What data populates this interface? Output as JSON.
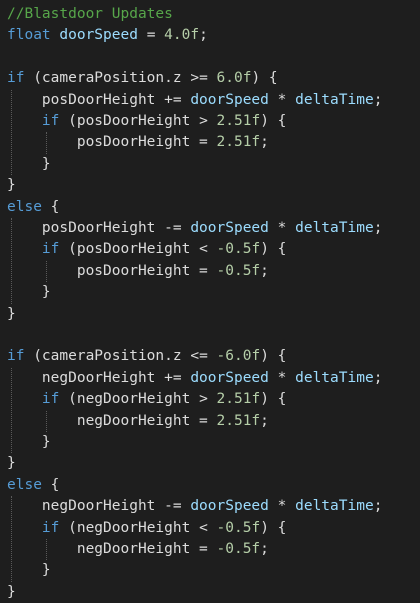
{
  "editor": {
    "lines": [
      {
        "tokens": [
          {
            "t": "//Blastdoor Updates",
            "c": "comment"
          }
        ]
      },
      {
        "tokens": [
          {
            "t": "float",
            "c": "kw"
          },
          {
            "t": " ",
            "c": "plain"
          },
          {
            "t": "doorSpeed",
            "c": "var"
          },
          {
            "t": " = ",
            "c": "op"
          },
          {
            "t": "4.0f",
            "c": "num"
          },
          {
            "t": ";",
            "c": "plain"
          }
        ]
      },
      {
        "tokens": []
      },
      {
        "tokens": [
          {
            "t": "if",
            "c": "kw"
          },
          {
            "t": " (cameraPosition.z >= ",
            "c": "plain"
          },
          {
            "t": "6.0f",
            "c": "num"
          },
          {
            "t": ") {",
            "c": "plain"
          }
        ]
      },
      {
        "tokens": [
          {
            "t": "    posDoorHeight += ",
            "c": "plain"
          },
          {
            "t": "doorSpeed",
            "c": "var"
          },
          {
            "t": " * ",
            "c": "op"
          },
          {
            "t": "deltaTime",
            "c": "var"
          },
          {
            "t": ";",
            "c": "plain"
          }
        ]
      },
      {
        "tokens": [
          {
            "t": "    ",
            "c": "plain"
          },
          {
            "t": "if",
            "c": "kw"
          },
          {
            "t": " (posDoorHeight > ",
            "c": "plain"
          },
          {
            "t": "2.51f",
            "c": "num"
          },
          {
            "t": ") {",
            "c": "plain"
          }
        ]
      },
      {
        "tokens": [
          {
            "t": "        posDoorHeight = ",
            "c": "plain"
          },
          {
            "t": "2.51f",
            "c": "num"
          },
          {
            "t": ";",
            "c": "plain"
          }
        ]
      },
      {
        "tokens": [
          {
            "t": "    }",
            "c": "plain"
          }
        ]
      },
      {
        "tokens": [
          {
            "t": "}",
            "c": "plain"
          }
        ]
      },
      {
        "tokens": [
          {
            "t": "else",
            "c": "kw"
          },
          {
            "t": " {",
            "c": "plain"
          }
        ]
      },
      {
        "tokens": [
          {
            "t": "    posDoorHeight -= ",
            "c": "plain"
          },
          {
            "t": "doorSpeed",
            "c": "var"
          },
          {
            "t": " * ",
            "c": "op"
          },
          {
            "t": "deltaTime",
            "c": "var"
          },
          {
            "t": ";",
            "c": "plain"
          }
        ]
      },
      {
        "tokens": [
          {
            "t": "    ",
            "c": "plain"
          },
          {
            "t": "if",
            "c": "kw"
          },
          {
            "t": " (posDoorHeight < ",
            "c": "plain"
          },
          {
            "t": "-0.5f",
            "c": "num"
          },
          {
            "t": ") {",
            "c": "plain"
          }
        ]
      },
      {
        "tokens": [
          {
            "t": "        posDoorHeight = ",
            "c": "plain"
          },
          {
            "t": "-0.5f",
            "c": "num"
          },
          {
            "t": ";",
            "c": "plain"
          }
        ]
      },
      {
        "tokens": [
          {
            "t": "    }",
            "c": "plain"
          }
        ]
      },
      {
        "tokens": [
          {
            "t": "}",
            "c": "plain"
          }
        ]
      },
      {
        "tokens": []
      },
      {
        "tokens": [
          {
            "t": "if",
            "c": "kw"
          },
          {
            "t": " (cameraPosition.z <= ",
            "c": "plain"
          },
          {
            "t": "-6.0f",
            "c": "num"
          },
          {
            "t": ") {",
            "c": "plain"
          }
        ]
      },
      {
        "tokens": [
          {
            "t": "    negDoorHeight += ",
            "c": "plain"
          },
          {
            "t": "doorSpeed",
            "c": "var"
          },
          {
            "t": " * ",
            "c": "op"
          },
          {
            "t": "deltaTime",
            "c": "var"
          },
          {
            "t": ";",
            "c": "plain"
          }
        ]
      },
      {
        "tokens": [
          {
            "t": "    ",
            "c": "plain"
          },
          {
            "t": "if",
            "c": "kw"
          },
          {
            "t": " (negDoorHeight > ",
            "c": "plain"
          },
          {
            "t": "2.51f",
            "c": "num"
          },
          {
            "t": ") {",
            "c": "plain"
          }
        ]
      },
      {
        "tokens": [
          {
            "t": "        negDoorHeight = ",
            "c": "plain"
          },
          {
            "t": "2.51f",
            "c": "num"
          },
          {
            "t": ";",
            "c": "plain"
          }
        ]
      },
      {
        "tokens": [
          {
            "t": "    }",
            "c": "plain"
          }
        ]
      },
      {
        "tokens": [
          {
            "t": "}",
            "c": "plain"
          }
        ]
      },
      {
        "tokens": [
          {
            "t": "else",
            "c": "kw"
          },
          {
            "t": " {",
            "c": "plain"
          }
        ]
      },
      {
        "tokens": [
          {
            "t": "    negDoorHeight -= ",
            "c": "plain"
          },
          {
            "t": "doorSpeed",
            "c": "var"
          },
          {
            "t": " * ",
            "c": "op"
          },
          {
            "t": "deltaTime",
            "c": "var"
          },
          {
            "t": ";",
            "c": "plain"
          }
        ]
      },
      {
        "tokens": [
          {
            "t": "    ",
            "c": "plain"
          },
          {
            "t": "if",
            "c": "kw"
          },
          {
            "t": " (negDoorHeight < ",
            "c": "plain"
          },
          {
            "t": "-0.5f",
            "c": "num"
          },
          {
            "t": ") {",
            "c": "plain"
          }
        ]
      },
      {
        "tokens": [
          {
            "t": "        negDoorHeight = ",
            "c": "plain"
          },
          {
            "t": "-0.5f",
            "c": "num"
          },
          {
            "t": ";",
            "c": "plain"
          }
        ]
      },
      {
        "tokens": [
          {
            "t": "    }",
            "c": "plain"
          }
        ]
      },
      {
        "tokens": [
          {
            "t": "}",
            "c": "plain"
          }
        ]
      }
    ]
  },
  "theme": {
    "background": "#1e1e1e",
    "comment": "#57a64a",
    "keyword": "#569cd6",
    "variable": "#9cdcfe",
    "number": "#b5cea8",
    "text": "#dcdcdc"
  }
}
